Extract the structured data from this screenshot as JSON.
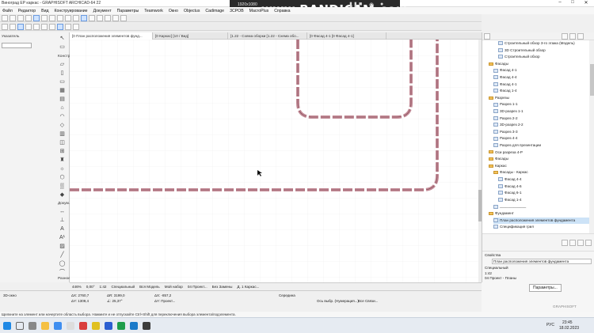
{
  "window": {
    "title": "Виноград ЕР каркас - GRAPHISOFT ARCHICAD-64 22"
  },
  "recorder": {
    "resolution": "1920x1080",
    "logo": "www.BANDICAM.com"
  },
  "menu": [
    "Файл",
    "Редактор",
    "Вид",
    "Конструирование",
    "Документ",
    "Параметры",
    "Teamwork",
    "Окно",
    "Objectus",
    "Cadimage",
    "3CPOB",
    "MacroPlus",
    "Справка"
  ],
  "toolbox": {
    "select_label": "Указатель",
    "design_label": "Констр.",
    "document_label": "Докум.",
    "other_label": "Разное"
  },
  "tabs": [
    "[0 План расположения элементов фунд...",
    "[0 Каркас] [10 / Вид]",
    "[1.22 - Схема оборки [1.22 - Схема обо...",
    "[0 Фасад 4-1 [0 Фасад 4-1]"
  ],
  "canvas_status": {
    "zoom": "446%",
    "angle": "0,00°",
    "scale": "1:42",
    "layer_set": "Специальный",
    "model": "Вся Модель",
    "pen": "Мой набор",
    "view": "04 Проект...",
    "renovation": "Без Замены",
    "partial": "Д. 1 Каркас..."
  },
  "info_box": {
    "dx_label": "ΔX: 2760,7",
    "dy_label": "ΔY: 1309,4",
    "r_label": "ΔR: 3199,0",
    "angle_label": "∠: 25,37°",
    "x_label": "ΔX: -857,2",
    "y_label": "ΔY: Проект...",
    "mode": "3D-окно",
    "align": "Середина",
    "snap": "Ось выбр. (Нумерация...)",
    "snap2": "Все Связи..."
  },
  "status_line": "Щелкните на элемент или начертите область выбора. Нажмите и не отпускайте Ctrl+Shift для переключения выбора элемента/подэлемента.",
  "navigator": {
    "items": [
      {
        "label": "Строительный обзор 3-го этажа (Модель)",
        "icon": "view",
        "indent": 3
      },
      {
        "label": "3D Строительный обзор",
        "icon": "view",
        "indent": 3
      },
      {
        "label": "Строительный обзор",
        "icon": "view",
        "indent": 3
      },
      {
        "label": "Фасады",
        "icon": "folder",
        "indent": 1
      },
      {
        "label": "Фасад 4-1",
        "icon": "view",
        "indent": 2
      },
      {
        "label": "Фасад 4-4",
        "icon": "view",
        "indent": 2
      },
      {
        "label": "Фасад 4-1",
        "icon": "view",
        "indent": 2
      },
      {
        "label": "Фасад 1-4",
        "icon": "view",
        "indent": 2
      },
      {
        "label": "Разрезы",
        "icon": "folder",
        "indent": 1
      },
      {
        "label": "Разрез 1-1",
        "icon": "view",
        "indent": 2
      },
      {
        "label": "3D-разрез 1-1",
        "icon": "view",
        "indent": 2
      },
      {
        "label": "Разрез 2-2",
        "icon": "view",
        "indent": 2
      },
      {
        "label": "3D-разрез 2-2",
        "icon": "view",
        "indent": 2
      },
      {
        "label": "Разрез 3-3",
        "icon": "view",
        "indent": 2
      },
      {
        "label": "Разрез 4-4",
        "icon": "view",
        "indent": 2
      },
      {
        "label": "Разрез для презентации",
        "icon": "view",
        "indent": 2
      },
      {
        "label": "Оси разреза 4-Р",
        "icon": "folder",
        "indent": 1
      },
      {
        "label": "Фасады",
        "icon": "folder",
        "indent": 1
      },
      {
        "label": "Каркас",
        "icon": "folder",
        "indent": 1
      },
      {
        "label": "Фасады - Каркас",
        "icon": "folder",
        "indent": 2
      },
      {
        "label": "Фасад 4-4",
        "icon": "view",
        "indent": 3
      },
      {
        "label": "Фасад 4-6",
        "icon": "view",
        "indent": 3
      },
      {
        "label": "Фасад 6-1",
        "icon": "view",
        "indent": 3
      },
      {
        "label": "Фасад 1-4",
        "icon": "view",
        "indent": 3
      },
      {
        "label": "_____________",
        "icon": "view",
        "indent": 2
      },
      {
        "label": "Фундамент",
        "icon": "folder",
        "indent": 1
      },
      {
        "label": "План расположения элементов фундамента",
        "icon": "view",
        "indent": 2,
        "selected": true
      },
      {
        "label": "Спецификация грил",
        "icon": "view",
        "indent": 2
      }
    ],
    "props_title": "Свойства",
    "props_name": "План расположения элементов фундамента",
    "props_layer": "Специальный",
    "props_scale": "1:42",
    "props_view": "04 Проект - Планы",
    "params_button": "Параметры..."
  },
  "brand": "GRAPHISOFT",
  "clock": {
    "time": "23:45",
    "date": "18.02.2023",
    "lang": "РУС"
  }
}
